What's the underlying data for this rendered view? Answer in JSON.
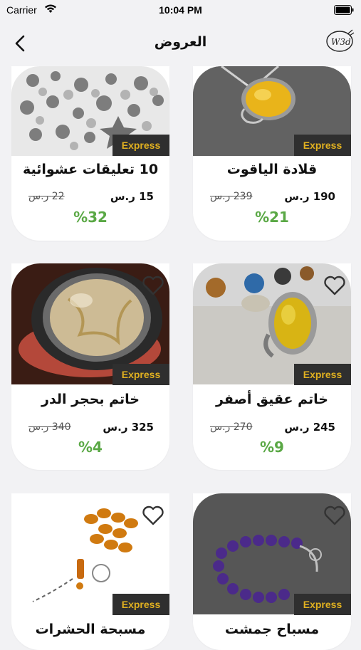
{
  "status": {
    "carrier": "Carrier",
    "time": "10:04 PM"
  },
  "nav": {
    "title": "العروض",
    "logo_text": "W3d"
  },
  "badge": "Express",
  "products": [
    {
      "name": "قلادة الياقوت",
      "price": "190 ر.س",
      "old": "239 ر.س",
      "discount": "%21"
    },
    {
      "name": "10 تعليقات عشوائية",
      "price": "15 ر.س",
      "old": "22 ر.س",
      "discount": "%32"
    },
    {
      "name": "خاتم عقيق أصفر",
      "price": "245 ر.س",
      "old": "270 ر.س",
      "discount": "%9"
    },
    {
      "name": "خاتم بحجر الدر",
      "price": "325 ر.س",
      "old": "340 ر.س",
      "discount": "%4"
    },
    {
      "name": "مسباح جمشت",
      "price": "",
      "old": "",
      "discount": ""
    },
    {
      "name": "مسبحة الحشرات",
      "price": "",
      "old": "",
      "discount": ""
    }
  ],
  "colors": {
    "express_bg": "#2f2f2f",
    "express_text": "#e0b020",
    "discount": "#5aa845",
    "background": "#f2f2f4"
  }
}
